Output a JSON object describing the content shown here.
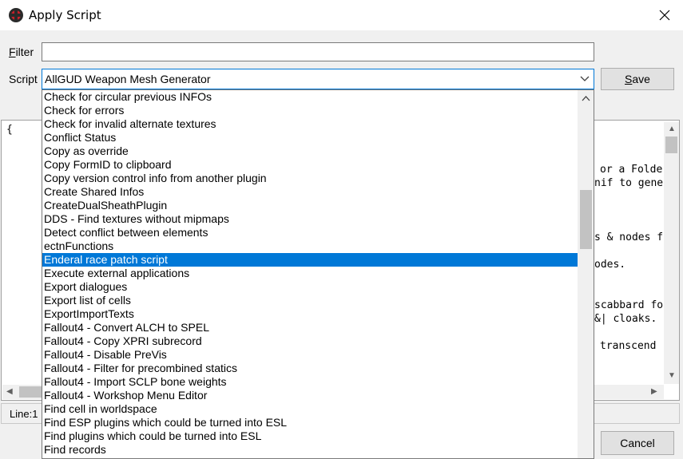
{
  "window": {
    "title": "Apply Script"
  },
  "filter": {
    "label": "Filter",
    "value": ""
  },
  "script": {
    "label": "Script",
    "selected": "AllGUD Weapon Mesh Generator"
  },
  "buttons": {
    "save": "Save",
    "cancel": "Cancel"
  },
  "editor": {
    "lines": [
      "{",
      "or a Folde",
      "nif to gene",
      "s & nodes f",
      "odes.",
      "scabbard fo",
      "&| cloaks.",
      "transcend"
    ]
  },
  "status": {
    "line": "Line:1"
  },
  "dropdown": {
    "items": [
      "Check for circular previous INFOs",
      "Check for errors",
      "Check for invalid alternate textures",
      "Conflict Status",
      "Copy as override",
      "Copy FormID to clipboard",
      "Copy version control info from another plugin",
      "Create Shared Infos",
      "CreateDualSheathPlugin",
      "DDS - Find textures without mipmaps",
      "Detect conflict between elements",
      "ectnFunctions",
      "Enderal race patch script",
      "Execute external applications",
      "Export dialogues",
      "Export list of cells",
      "ExportImportTexts",
      "Fallout4 - Convert ALCH to SPEL",
      "Fallout4 - Copy XPRI subrecord",
      "Fallout4 - Disable PreVis",
      "Fallout4 - Filter for precombined statics",
      "Fallout4 - Import SCLP bone weights",
      "Fallout4 - Workshop Menu Editor",
      "Find cell in worldspace",
      "Find ESP plugins which could be turned into ESL",
      "Find plugins which could be turned into ESL",
      "Find records"
    ],
    "selected_index": 12
  },
  "colors": {
    "selection": "#0078d7",
    "window_bg": "#f0f0f0"
  }
}
